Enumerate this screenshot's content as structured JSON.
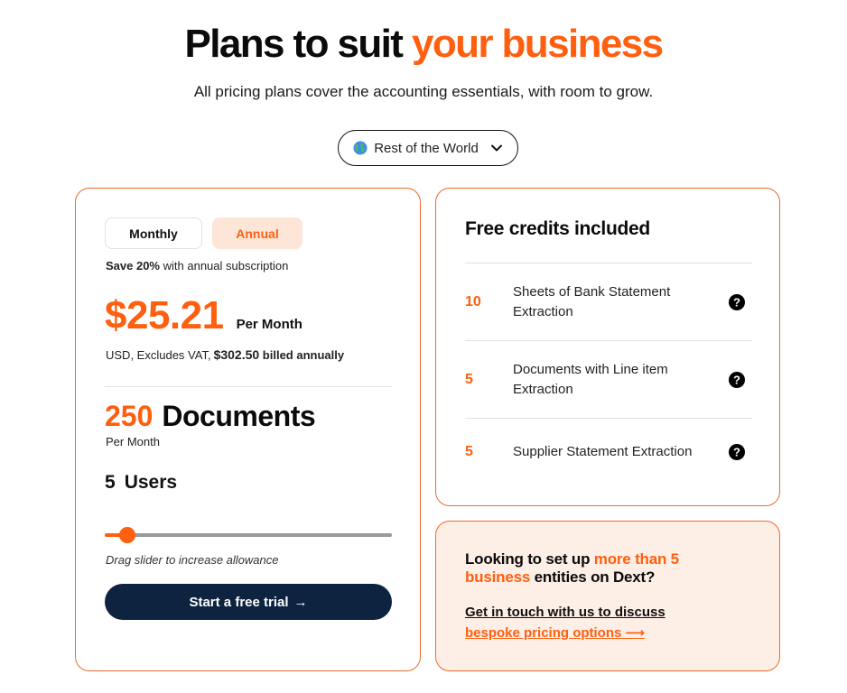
{
  "header": {
    "title_plain": "Plans to suit ",
    "title_accent": "your business",
    "subtitle": "All pricing plans cover the accounting essentials, with room to grow."
  },
  "region": {
    "icon": "globe-icon",
    "label": "Rest of the World",
    "chevron": "chevron-down-icon"
  },
  "plan": {
    "toggle": {
      "monthly": "Monthly",
      "annual": "Annual",
      "selected": "Annual"
    },
    "save_bold": "Save 20%",
    "save_rest": "with annual subscription",
    "price": "$25.21",
    "price_unit": "Per Month",
    "price_note": "USD, Excludes VAT,",
    "billed_amount": "$302.50",
    "billed_text": "billed annually",
    "documents_count": "250",
    "documents_label": "Documents",
    "documents_period": "Per Month",
    "users_count": "5",
    "users_label": "Users",
    "slider_level_fraction": 0.08,
    "slider_hint": "Drag slider to increase allowance",
    "cta_label": "Start a free trial",
    "cta_arrow": "→"
  },
  "credits": {
    "title": "Free credits included",
    "items": [
      {
        "qty": "10",
        "label": "Sheets of Bank Statement Extraction",
        "icon": "help-icon"
      },
      {
        "qty": "5",
        "label": "Documents with Line item Extraction",
        "icon": "help-icon"
      },
      {
        "qty": "5",
        "label": "Supplier Statement Extraction",
        "icon": "help-icon"
      }
    ]
  },
  "contact": {
    "heading_pre": "Looking to set up ",
    "heading_accent": "more than 5 business",
    "heading_post": " entities on Dext?",
    "link_line1": "Get in touch with us to discuss",
    "link_line2": "bespoke pricing options",
    "link_arrow": "⟶"
  },
  "colors": {
    "accent": "#ff5f0f",
    "navy": "#0d2340",
    "card_border": "#ee6a2c",
    "contact_bg": "#fdeee6",
    "toggle_active_bg": "#fde6d8"
  }
}
